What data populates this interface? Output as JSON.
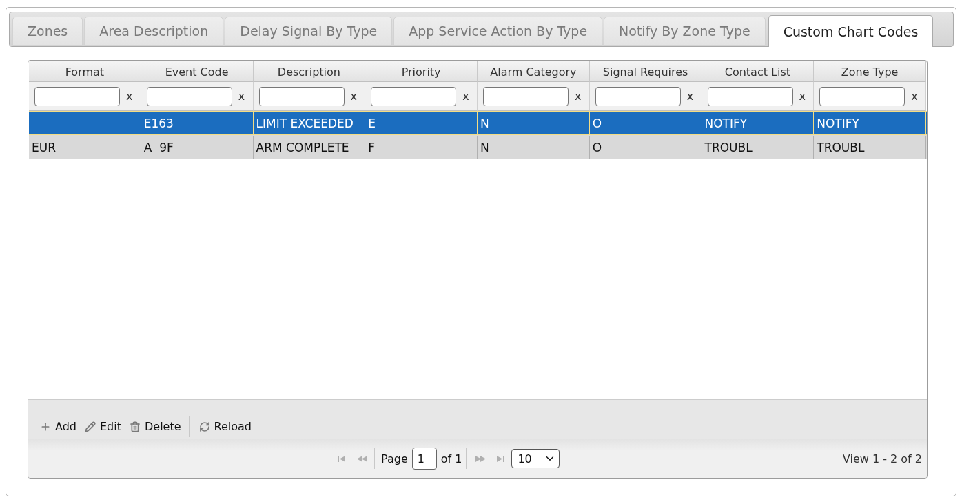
{
  "tabs": [
    {
      "label": "Zones",
      "selected": false
    },
    {
      "label": "Area Description",
      "selected": false
    },
    {
      "label": "Delay Signal By Type",
      "selected": false
    },
    {
      "label": "App Service Action By Type",
      "selected": false
    },
    {
      "label": "Notify By Zone Type",
      "selected": false
    },
    {
      "label": "Custom Chart Codes",
      "selected": true
    }
  ],
  "grid": {
    "columns": [
      {
        "title": "Format",
        "filter_clear": "x"
      },
      {
        "title": "Event Code",
        "filter_clear": "x"
      },
      {
        "title": "Description",
        "filter_clear": "x"
      },
      {
        "title": "Priority",
        "filter_clear": "x"
      },
      {
        "title": "Alarm Category",
        "filter_clear": "x"
      },
      {
        "title": "Signal Requires",
        "filter_clear": "x"
      },
      {
        "title": "Contact List",
        "filter_clear": "x"
      },
      {
        "title": "Zone Type",
        "filter_clear": "x"
      }
    ],
    "rows": [
      {
        "selected": true,
        "cells": [
          null,
          "E163",
          "LIMIT EXCEEDED",
          "E",
          "N",
          "O",
          "NOTIFY",
          "NOTIFY"
        ]
      },
      {
        "selected": false,
        "cells": [
          "EUR",
          "A  9F",
          "ARM COMPLETE",
          "F",
          "N",
          "O",
          "TROUBL",
          "TROUBL"
        ]
      }
    ],
    "toolbar": [
      {
        "kind": "add",
        "label": "Add"
      },
      {
        "kind": "edit",
        "label": "Edit"
      },
      {
        "kind": "delete",
        "label": "Delete"
      },
      {
        "kind": "separator"
      },
      {
        "kind": "reload",
        "label": "Reload"
      }
    ],
    "pager": {
      "nav": [
        {
          "kind": "first",
          "disabled": true
        },
        {
          "kind": "prev",
          "disabled": true
        },
        {
          "kind": "next",
          "disabled": true
        },
        {
          "kind": "last",
          "disabled": true
        }
      ],
      "page_label": "Page",
      "page": "1",
      "total_label": "of 1",
      "page_size": "10",
      "summary": "View 1 - 2 of 2"
    }
  }
}
